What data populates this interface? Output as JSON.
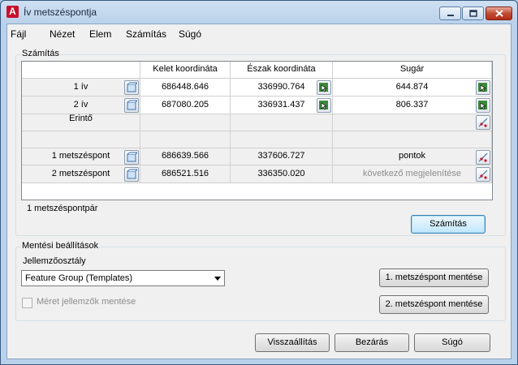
{
  "window": {
    "title": "Ív metszéspontja",
    "app_icon_letter": "A"
  },
  "menu": [
    "Fájl",
    "Nézet",
    "Elem",
    "Számítás",
    "Súgó"
  ],
  "szamitas": {
    "group_label": "Számítás",
    "columns": [
      "Kelet koordináta",
      "Észak koordináta",
      "Sugár"
    ],
    "rows": {
      "iv1": {
        "label": "1 ív",
        "kelet": "686448.646",
        "eszak": "336990.764",
        "sugar": "644.874"
      },
      "iv2": {
        "label": "2 ív",
        "kelet": "687080.205",
        "eszak": "336931.437",
        "sugar": "806.337"
      },
      "erinto": {
        "label": "Érintő"
      },
      "m1": {
        "label": "1 metszéspont",
        "kelet": "686639.566",
        "eszak": "337606.727",
        "sugar": "pontok"
      },
      "m2": {
        "label": "2 metszéspont",
        "kelet": "686521.516",
        "eszak": "336350.020",
        "sugar": "következő megjelenítése"
      }
    },
    "pair_count": "1 metszéspontpár",
    "calc_button": "Számítás"
  },
  "mentes": {
    "group_label": "Mentési beállítások",
    "class_label": "Jellemzőosztály",
    "class_value": "Feature Group (Templates)",
    "checkbox_label": "Méret jellemzők mentése",
    "checkbox_checked": false,
    "save1": "1. metszéspont mentése",
    "save2": "2. metszéspont mentése"
  },
  "footer": {
    "reset": "Visszaállítás",
    "close": "Bezárás",
    "help": "Súgó"
  }
}
